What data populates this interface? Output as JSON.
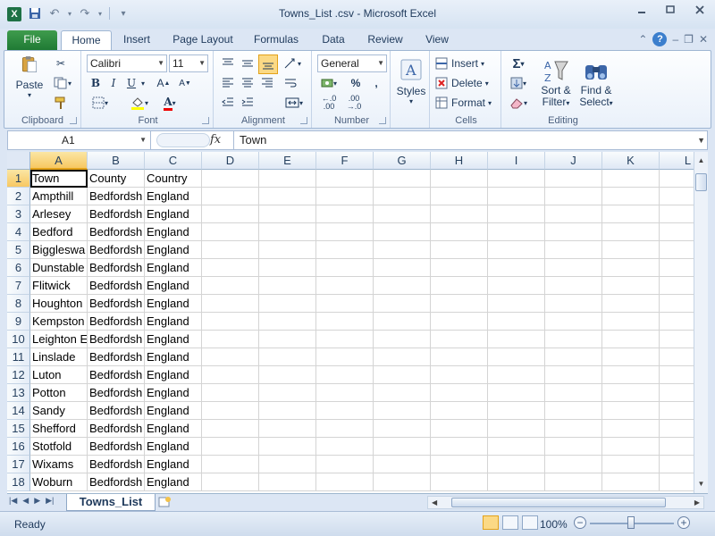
{
  "window": {
    "title": "Towns_List .csv  -  Microsoft Excel",
    "app_icon": "X"
  },
  "quick_access": {
    "icons": [
      "save-icon",
      "undo-icon",
      "redo-icon",
      "customize-icon"
    ]
  },
  "ribbon_tabs": {
    "file": "File",
    "home": "Home",
    "insert": "Insert",
    "page_layout": "Page Layout",
    "formulas": "Formulas",
    "data": "Data",
    "review": "Review",
    "view": "View"
  },
  "clipboard": {
    "paste": "Paste",
    "label": "Clipboard"
  },
  "font": {
    "name": "Calibri",
    "size": "11",
    "bold": "B",
    "italic": "I",
    "underline": "U",
    "label": "Font"
  },
  "alignment": {
    "label": "Alignment"
  },
  "number": {
    "format": "General",
    "currency": "$",
    "percent": "%",
    "comma": ",",
    "label": "Number"
  },
  "styles": {
    "label": "Styles"
  },
  "cells": {
    "insert": "Insert",
    "delete": "Delete",
    "format": "Format",
    "label": "Cells"
  },
  "editing": {
    "sum": "Σ",
    "sort_filter_1": "Sort &",
    "sort_filter_2": "Filter",
    "find_select_1": "Find &",
    "find_select_2": "Select",
    "label": "Editing"
  },
  "formula_bar": {
    "name_box": "A1",
    "fx": "fx",
    "content": "Town"
  },
  "columns": [
    "A",
    "B",
    "C",
    "D",
    "E",
    "F",
    "G",
    "H",
    "I",
    "J",
    "K",
    "L"
  ],
  "rows": [
    {
      "n": "1",
      "cells": [
        "Town",
        "County",
        "Country"
      ]
    },
    {
      "n": "2",
      "cells": [
        "Ampthill",
        "Bedfordsh",
        "England"
      ]
    },
    {
      "n": "3",
      "cells": [
        "Arlesey",
        "Bedfordsh",
        "England"
      ]
    },
    {
      "n": "4",
      "cells": [
        "Bedford",
        "Bedfordsh",
        "England"
      ]
    },
    {
      "n": "5",
      "cells": [
        "Biggleswa",
        "Bedfordsh",
        "England"
      ]
    },
    {
      "n": "6",
      "cells": [
        "Dunstable",
        "Bedfordsh",
        "England"
      ]
    },
    {
      "n": "7",
      "cells": [
        "Flitwick",
        "Bedfordsh",
        "England"
      ]
    },
    {
      "n": "8",
      "cells": [
        "Houghton",
        "Bedfordsh",
        "England"
      ]
    },
    {
      "n": "9",
      "cells": [
        "Kempston",
        "Bedfordsh",
        "England"
      ]
    },
    {
      "n": "10",
      "cells": [
        "Leighton E",
        "Bedfordsh",
        "England"
      ]
    },
    {
      "n": "11",
      "cells": [
        "Linslade",
        "Bedfordsh",
        "England"
      ]
    },
    {
      "n": "12",
      "cells": [
        "Luton",
        "Bedfordsh",
        "England"
      ]
    },
    {
      "n": "13",
      "cells": [
        "Potton",
        "Bedfordsh",
        "England"
      ]
    },
    {
      "n": "14",
      "cells": [
        "Sandy",
        "Bedfordsh",
        "England"
      ]
    },
    {
      "n": "15",
      "cells": [
        "Shefford",
        "Bedfordsh",
        "England"
      ]
    },
    {
      "n": "16",
      "cells": [
        "Stotfold",
        "Bedfordsh",
        "England"
      ]
    },
    {
      "n": "17",
      "cells": [
        "Wixams",
        "Bedfordsh",
        "England"
      ]
    },
    {
      "n": "18",
      "cells": [
        "Woburn",
        "Bedfordsh",
        "England"
      ]
    }
  ],
  "sheet_tabs": {
    "active": "Towns_List"
  },
  "status_bar": {
    "ready": "Ready",
    "zoom": "100%",
    "zoom_minus": "−",
    "zoom_plus": "+"
  }
}
